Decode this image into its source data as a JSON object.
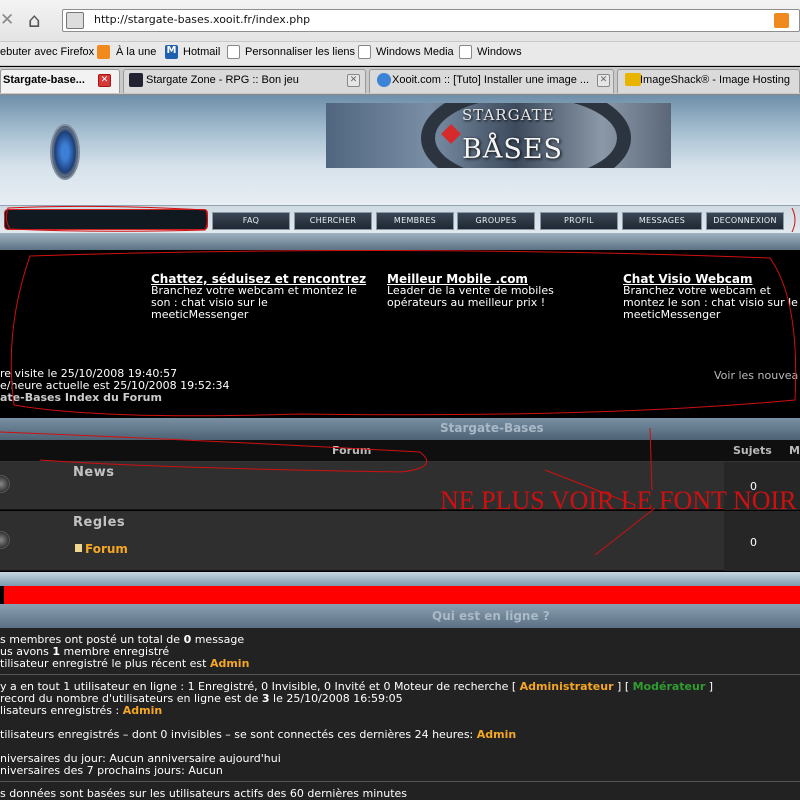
{
  "browser": {
    "url": "http://stargate-bases.xooit.fr/index.php",
    "bookmarks": [
      "ebuter avec Firefox",
      "À la une",
      "Hotmail",
      "Personnaliser les liens",
      "Windows Media",
      "Windows"
    ],
    "tabs": [
      "Stargate-base...",
      "Stargate Zone - RPG :: Bon jeu",
      "Xooit.com :: [Tuto] Installer une image ...",
      "ImageShack® - Image Hosting"
    ]
  },
  "header": {
    "banner_top": "STARGATE",
    "banner_main": "BÅSES"
  },
  "nav": {
    "items": [
      "FAQ",
      "CHERCHER",
      "MEMBRES",
      "GROUPES",
      "PROFIL",
      "MESSAGES",
      "DECONNEXION"
    ]
  },
  "ads": [
    {
      "title": "Chattez, séduisez et rencontrez",
      "text": "Branchez votre webcam et montez le son : chat visio sur le meeticMessenger"
    },
    {
      "title": "Meilleur Mobile .com",
      "text": "Leader de la vente de mobiles opérateurs au meilleur prix !"
    },
    {
      "title": "Chat Visio Webcam",
      "text": "Branchez votre webcam et montez le son : chat visio sur le meeticMessenger"
    }
  ],
  "info": {
    "last_visit": "re visite le 25/10/2008 19:40:57",
    "current_time": "e/heure actuelle est 25/10/2008 19:52:34",
    "index_link": "ate-Bases Index du Forum",
    "view_new": "Voir les nouvea"
  },
  "forum": {
    "category": "Stargate-Bases",
    "col_forum": "Forum",
    "col_topics": "Sujets",
    "col_msgs": "M",
    "rows": [
      {
        "name": "News",
        "topics": "0"
      },
      {
        "name": "Regles",
        "topics": "0",
        "subforum": "Forum"
      }
    ]
  },
  "annotation": "NE PLUS VOIR LE FONT NOIR",
  "online": {
    "title": "Qui est en ligne ?",
    "l1a": "s membres ont posté un total de ",
    "l1b": "0",
    "l1c": " message",
    "l2a": "us avons ",
    "l2b": "1",
    "l2c": " membre enregistré",
    "l3a": "tilisateur enregistré le plus récent est ",
    "l3b": "Admin",
    "l4": "y a en tout 1 utilisateur en ligne : 1 Enregistré, 0 Invisible, 0 Invité et 0 Moteur de recherche   [ ",
    "l4_admin": "Administrateur",
    "l4_mid": " ]   [ ",
    "l4_mod": "Modérateur",
    "l4_end": " ]",
    "l5a": "record du nombre d'utilisateurs en ligne est de ",
    "l5b": "3",
    "l5c": " le 25/10/2008 16:59:05",
    "l6a": "lisateurs enregistrés : ",
    "l6b": "Admin",
    "l7a": "tilisateurs enregistrés – dont 0 invisibles – se sont connectés ces dernières 24 heures: ",
    "l7b": "Admin",
    "l8": "niversaires du jour: Aucun anniversaire aujourd'hui",
    "l9": "niversaires des 7 prochains jours: Aucun",
    "l10": "s données sont basées sur les utilisateurs actifs des 60 dernières minutes"
  },
  "colors": {
    "annotation": "#d01010",
    "accent": "#f5a623",
    "moderator": "#2f9d2f",
    "redbar": "#ff0000"
  }
}
